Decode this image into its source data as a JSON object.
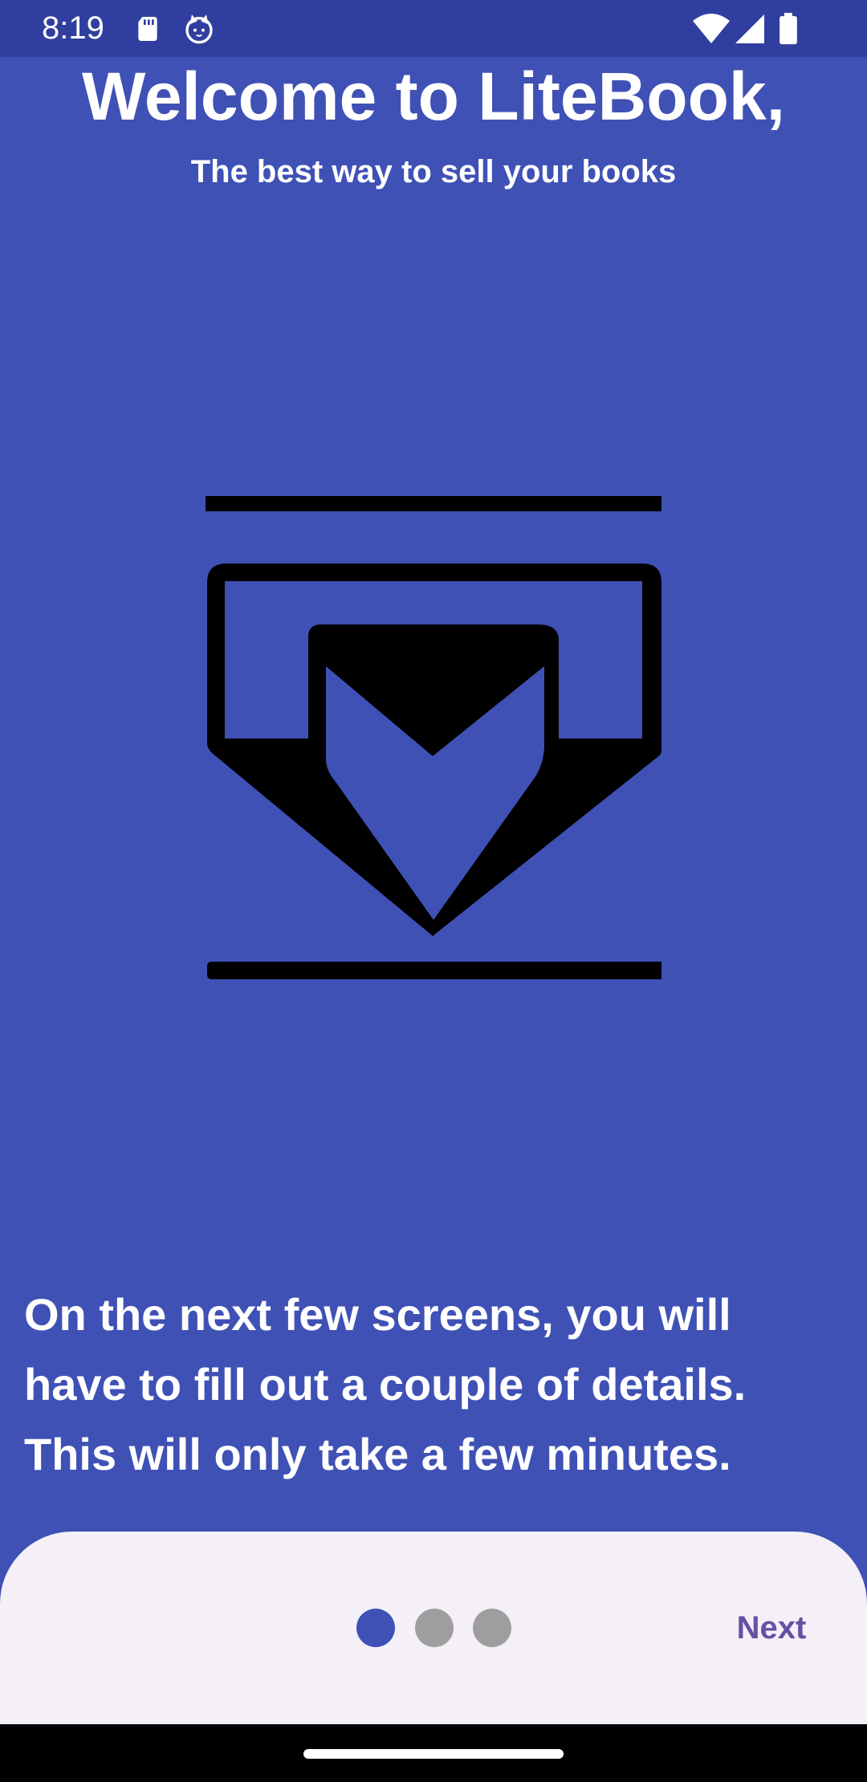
{
  "status_bar": {
    "time": "8:19",
    "icons": [
      "sd-card-icon",
      "cat-icon",
      "wifi-icon",
      "signal-icon",
      "battery-icon"
    ]
  },
  "welcome": {
    "title": "Welcome to LiteBook,",
    "subtitle": "The best way to sell your books",
    "hero_icon": "mail-inbox-download-icon",
    "description": "On the next few screens, you will have to fill out a couple of details. This will only take a few minutes."
  },
  "pager": {
    "total": 3,
    "current": 1
  },
  "actions": {
    "next_label": "Next"
  },
  "colors": {
    "primary": "#3F51B5",
    "primary_dark": "#303F9F",
    "sheet_background": "#F5F0F8",
    "accent_text": "#6750A4",
    "dot_inactive": "#9E9E9E"
  }
}
